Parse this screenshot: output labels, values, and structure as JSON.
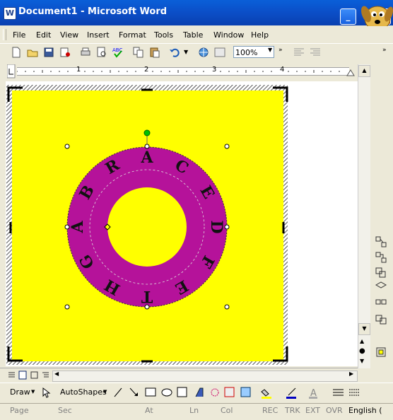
{
  "window": {
    "title": "Document1 - Microsoft Word",
    "app_icon": "W"
  },
  "menu": [
    "File",
    "Edit",
    "View",
    "Insert",
    "Format",
    "Tools",
    "Table",
    "Window",
    "Help"
  ],
  "toolbar": {
    "zoom": "100%"
  },
  "ruler": {
    "numbers": [
      "1",
      "2",
      "3",
      "4"
    ]
  },
  "wordart": {
    "letters": [
      "B",
      "R",
      "A",
      "C",
      "E",
      "D",
      "F",
      "E",
      "T",
      "H",
      "G",
      "A"
    ],
    "ring_color": "#b5129a",
    "page_color": "#ffff00"
  },
  "drawbar": {
    "draw_label": "Draw",
    "autoshapes_label": "AutoShapes"
  },
  "status": {
    "page": "Page",
    "sec": "Sec",
    "at": "At",
    "ln": "Ln",
    "col": "Col",
    "rec": "REC",
    "trk": "TRK",
    "ext": "EXT",
    "ovr": "OVR",
    "language": "English ("
  },
  "colors": {
    "titlebar": "#0b4ec7",
    "chrome": "#ece9d8",
    "selection_handle": "#00c000"
  }
}
